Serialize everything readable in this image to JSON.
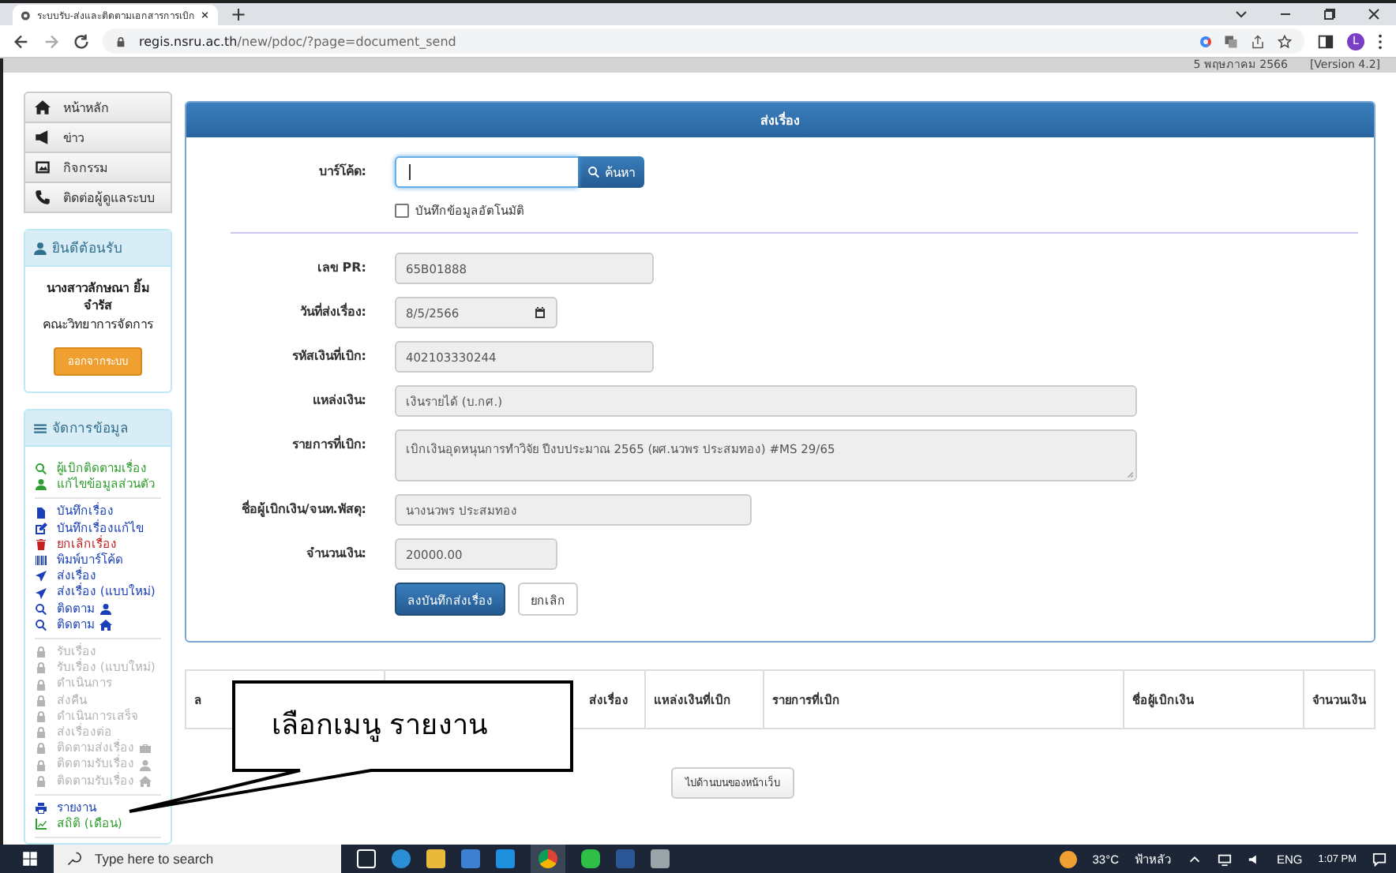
{
  "browser": {
    "tab_title": "ระบบรับ-ส่งและติดตามเอกสารการเบิก",
    "new_tab": "+",
    "url_host": "regis.nsru.ac.th",
    "url_path": "/new/pdoc/?page=document_send",
    "avatar": "L"
  },
  "header_strip": {
    "date": "5 พฤษภาคม 2566",
    "version": "[Version 4.2]"
  },
  "nav": [
    {
      "label": "หน้าหลัก"
    },
    {
      "label": "ข่าว"
    },
    {
      "label": "กิจกรรม"
    },
    {
      "label": "ติดต่อผู้ดูแลระบบ"
    }
  ],
  "welcome": {
    "title": "ยินดีต้อนรับ",
    "name": "นางสาวลักษณา ยิ้มจำรัส",
    "faculty": "คณะวิทยาการจัดการ",
    "logout": "ออกจากระบบ"
  },
  "data_menu": {
    "title": "จัดการข้อมูล",
    "groups": [
      {
        "items": [
          {
            "label": "ผู้เบิกติดตามเรื่อง",
            "color": "#2e9e2e",
            "disabled": false
          },
          {
            "label": "แก้ไขข้อมูลส่วนตัว",
            "color": "#2e9e2e",
            "disabled": false
          }
        ]
      },
      {
        "items": [
          {
            "label": "บันทึกเรื่อง",
            "color": "#1a3fb8",
            "disabled": false
          },
          {
            "label": "บันทึกเรื่องแก้ไข",
            "color": "#1a3fb8",
            "disabled": false
          },
          {
            "label": "ยกเลิกเรื่อง",
            "color": "#c42020",
            "disabled": false
          },
          {
            "label": "พิมพ์บาร์โค้ด",
            "color": "#1a3fb8",
            "disabled": false
          },
          {
            "label": "ส่งเรื่อง",
            "color": "#1a3fb8",
            "disabled": false
          },
          {
            "label": "ส่งเรื่อง (แบบใหม่)",
            "color": "#1a3fb8",
            "disabled": false
          },
          {
            "label": "ติดตาม",
            "color": "#1a3fb8",
            "disabled": false
          },
          {
            "label": "ติดตาม",
            "color": "#1a3fb8",
            "disabled": false
          }
        ]
      },
      {
        "items": [
          {
            "label": "รับเรื่อง",
            "color": "#b4b4b4",
            "disabled": true
          },
          {
            "label": "รับเรื่อง (แบบใหม่)",
            "color": "#b4b4b4",
            "disabled": true
          },
          {
            "label": "ดำเนินการ",
            "color": "#b4b4b4",
            "disabled": true
          },
          {
            "label": "ส่งคืน",
            "color": "#b4b4b4",
            "disabled": true
          },
          {
            "label": "ดำเนินการเสร็จ",
            "color": "#b4b4b4",
            "disabled": true
          },
          {
            "label": "ส่งเรื่องต่อ",
            "color": "#b4b4b4",
            "disabled": true
          },
          {
            "label": "ติดตามส่งเรื่อง",
            "color": "#b4b4b4",
            "disabled": true
          },
          {
            "label": "ติดตามรับเรื่อง",
            "color": "#b4b4b4",
            "disabled": true
          },
          {
            "label": "ติดตามรับเรื่อง",
            "color": "#b4b4b4",
            "disabled": true
          }
        ]
      },
      {
        "items": [
          {
            "label": "รายงาน",
            "color": "#1a3fb8",
            "disabled": false
          },
          {
            "label": "สถิติ (เดือน)",
            "color": "#2e9e2e",
            "disabled": false
          }
        ]
      }
    ]
  },
  "form": {
    "title": "ส่งเรื่อง",
    "barcode": {
      "label": "บาร์โค้ด:",
      "focused": true,
      "search": "ค้นหา"
    },
    "auto_save": {
      "label": "บันทึกข้อมูลอัตโนมัติ",
      "checked": false
    },
    "fields": [
      {
        "label": "เลข PR:",
        "value": "65B01888",
        "kind": "short"
      },
      {
        "label": "วันที่ส่งเรื่อง:",
        "value": "8/5/2566",
        "kind": "date"
      },
      {
        "label": "รหัสเงินที่เบิก:",
        "value": "402103330244",
        "kind": "short"
      },
      {
        "label": "แหล่งเงิน:",
        "value": "เงินรายได้ (บ.กศ.)",
        "kind": "wide"
      },
      {
        "label": "รายการที่เบิก:",
        "value": "เบิกเงินอุดหนุนการทำวิจัย ปีงบประมาณ 2565 (ผศ.นวพร ประสมทอง) #MS 29/65",
        "kind": "textarea"
      },
      {
        "label": "ชื่อผู้เบิกเงิน/จนท.พัสดุ:",
        "value": "นางนวพร ประสมทอง",
        "kind": "medium"
      },
      {
        "label": "จำนวนเงิน:",
        "value": "20000.00",
        "kind": "amount"
      }
    ],
    "submit": "ลงบันทึกส่งเรื่อง",
    "cancel": "ยกเลิก"
  },
  "table": {
    "columns": [
      "ล",
      "ส่งเรื่อง",
      "แหล่งเงินที่เบิก",
      "รายการที่เบิก",
      "ชื่อผู้เบิกเงิน",
      "จำนวนเงิน"
    ]
  },
  "back_to_top": "ไปด้านบนของหน้าเว็บ",
  "callout": {
    "text": "เลือกเมนู รายงาน"
  },
  "taskbar": {
    "search_placeholder": "Type here to search",
    "temperature": "33°C",
    "weather": "ฟ้าหลัว",
    "language": "ENG",
    "time": "1:07 PM"
  }
}
